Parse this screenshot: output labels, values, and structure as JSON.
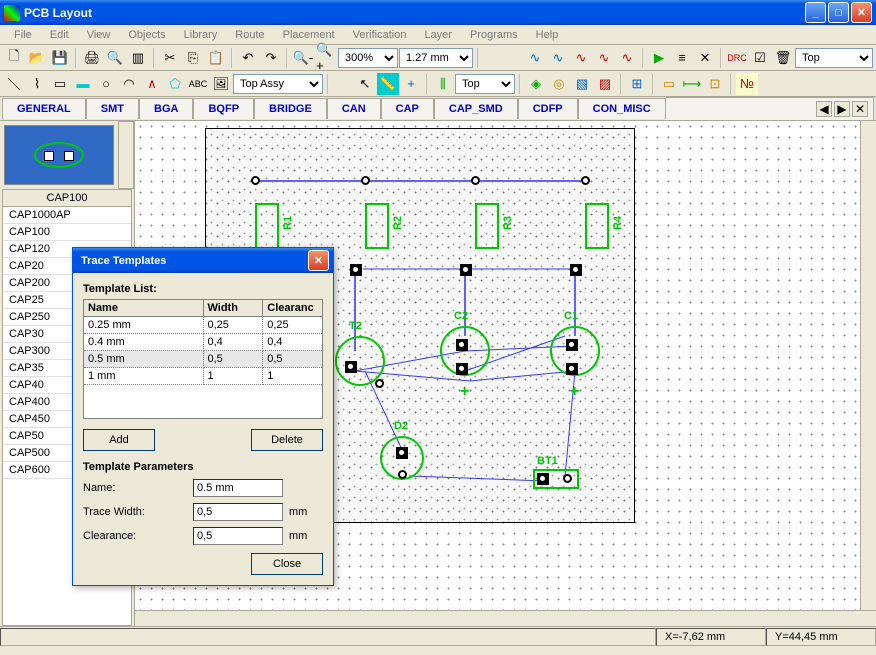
{
  "window": {
    "title": "PCB Layout"
  },
  "menu": {
    "items": [
      "File",
      "Edit",
      "View",
      "Objects",
      "Library",
      "Route",
      "Placement",
      "Verification",
      "Layer",
      "Programs",
      "Help"
    ]
  },
  "toolbar1": {
    "zoom_pct": "300%",
    "grid": "1.27 mm",
    "layer": "Top"
  },
  "toolbar2": {
    "assy_layer": "Top Assy",
    "text_abc": "ABC",
    "sel_layer": "Top"
  },
  "category_tabs": [
    "GENERAL",
    "SMT",
    "BGA",
    "BQFP",
    "BRIDGE",
    "CAN",
    "CAP",
    "CAP_SMD",
    "CDFP",
    "CON_MISC"
  ],
  "component_list": {
    "header": "CAP100",
    "items": [
      "CAP1000AP",
      "CAP100",
      "CAP120",
      "CAP20",
      "CAP200",
      "CAP25",
      "CAP250",
      "CAP30",
      "CAP300",
      "CAP35",
      "CAP40",
      "CAP400",
      "CAP450",
      "CAP50",
      "CAP500",
      "CAP600"
    ]
  },
  "board": {
    "labels": {
      "r1": "R1",
      "r2": "R2",
      "r3": "R3",
      "r4": "R4",
      "t2": "T2",
      "c2": "C2",
      "c1": "C1",
      "d2": "D2",
      "bt1": "BT1"
    }
  },
  "statusbar": {
    "x": "X=-7,62 mm",
    "y": "Y=44,45 mm"
  },
  "dialog": {
    "title": "Trace Templates",
    "list_label": "Template List:",
    "headers": {
      "name": "Name",
      "width": "Width",
      "clear": "Clearanc"
    },
    "rows": [
      {
        "name": "0.25 mm",
        "width": "0,25",
        "clear": "0,25"
      },
      {
        "name": "0.4 mm",
        "width": "0,4",
        "clear": "0,4"
      },
      {
        "name": "0.5 mm",
        "width": "0,5",
        "clear": "0,5"
      },
      {
        "name": "1 mm",
        "width": "1",
        "clear": "1"
      }
    ],
    "btn_add": "Add",
    "btn_delete": "Delete",
    "params_label": "Template Parameters",
    "p_name_lbl": "Name:",
    "p_name_val": "0.5 mm",
    "p_width_lbl": "Trace Width:",
    "p_width_val": "0,5",
    "p_clear_lbl": "Clearance:",
    "p_clear_val": "0,5",
    "unit": "mm",
    "btn_close": "Close"
  }
}
